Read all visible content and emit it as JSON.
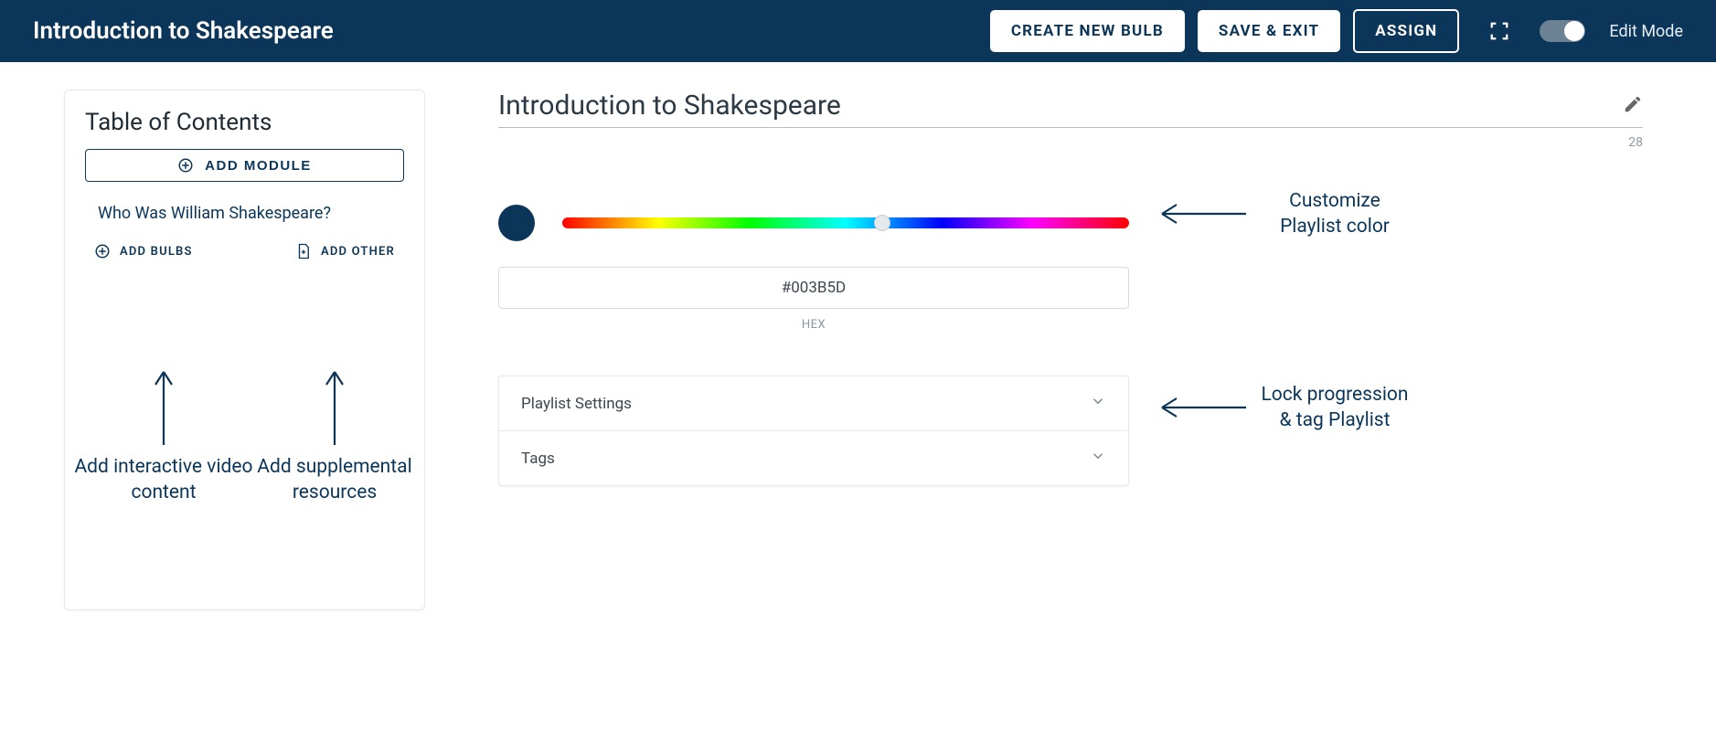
{
  "header": {
    "title": "Introduction to Shakespeare",
    "create_bulb_label": "CREATE NEW BULB",
    "save_exit_label": "SAVE & EXIT",
    "assign_label": "ASSIGN",
    "edit_mode_label": "Edit Mode"
  },
  "toc": {
    "title": "Table of Contents",
    "add_module_label": "ADD MODULE",
    "module_title": "Who Was William Shakespeare?",
    "add_bulbs_label": "ADD BULBS",
    "add_other_label": "ADD OTHER"
  },
  "annotations": {
    "add_bulbs_hint": "Add interactive video content",
    "add_other_hint": "Add supplemental resources",
    "color_hint": "Customize Playlist color",
    "settings_hint": "Lock progression & tag Playlist"
  },
  "main": {
    "title": "Introduction to Shakespeare",
    "char_count": "28",
    "hex_value": "#003B5D",
    "hex_label": "HEX",
    "accordion": {
      "settings_label": "Playlist Settings",
      "tags_label": "Tags"
    }
  },
  "colors": {
    "swatch": "#0b3659"
  }
}
